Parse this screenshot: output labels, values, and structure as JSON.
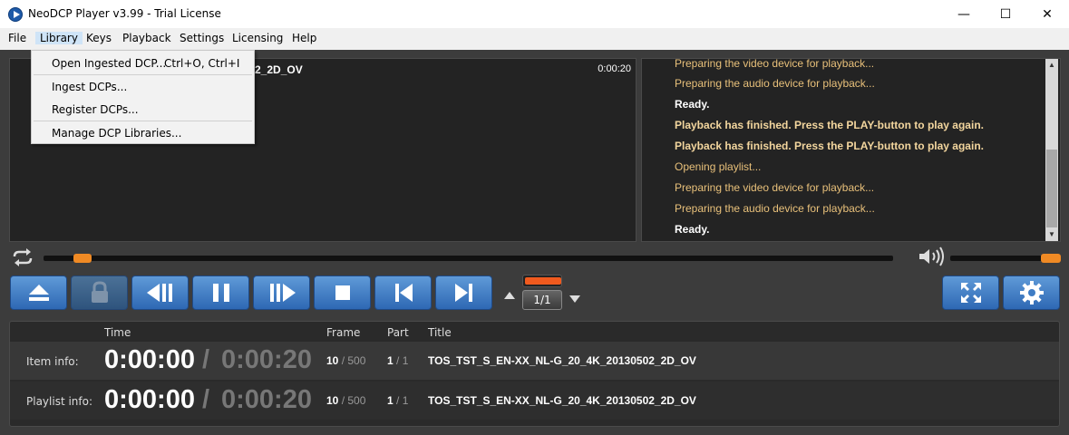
{
  "window": {
    "title": "NeoDCP Player v3.99 - Trial License",
    "minimize": "—",
    "maximize": "☐",
    "close": "✕"
  },
  "menubar": {
    "items": [
      "File",
      "Library",
      "Keys",
      "Playback",
      "Settings",
      "Licensing",
      "Help"
    ],
    "active": "Library"
  },
  "library_menu": {
    "items": [
      {
        "label": "Open Ingested DCP...",
        "shortcut": "Ctrl+O, Ctrl+I"
      },
      {
        "label": "Ingest DCPs...",
        "shortcut": ""
      },
      {
        "label": "Register DCPs...",
        "shortcut": ""
      },
      {
        "label": "Manage DCP Libraries...",
        "shortcut": ""
      }
    ]
  },
  "video": {
    "title_fragment": "2_2D_OV",
    "time": "0:00:20"
  },
  "log": {
    "lines": [
      {
        "text": "Preparing the video device for playback...",
        "style": "normal"
      },
      {
        "text": "Preparing the audio device for playback...",
        "style": "normal"
      },
      {
        "text": "Ready.",
        "style": "ready"
      },
      {
        "text": "Playback has finished. Press the PLAY-button to play again.",
        "style": "bold"
      },
      {
        "text": "Playback has finished. Press the PLAY-button to play again.",
        "style": "bold"
      },
      {
        "text": "Opening playlist...",
        "style": "normal"
      },
      {
        "text": "Preparing the video device for playback...",
        "style": "normal"
      },
      {
        "text": "Preparing the audio device for playback...",
        "style": "normal"
      },
      {
        "text": "Ready.",
        "style": "ready"
      }
    ]
  },
  "playback": {
    "seek_position": 0.02,
    "volume_level": 0.9,
    "playlist_counter": "1/1"
  },
  "controls": {
    "buttons": [
      "eject-icon",
      "lock-icon",
      "step-back-icon",
      "pause-icon",
      "step-forward-icon",
      "stop-icon",
      "skip-previous-icon",
      "skip-next-icon",
      "fullscreen-icon",
      "settings-icon"
    ]
  },
  "info": {
    "headers": {
      "time": "Time",
      "frame": "Frame",
      "part": "Part",
      "title": "Title"
    },
    "rows": [
      {
        "label": "Item info:",
        "time": "0:00:00",
        "sep": "/",
        "total": "0:00:20",
        "frame": "10",
        "frame_total": "/ 500",
        "part": "1",
        "part_total": "/ 1",
        "title": "TOS_TST_S_EN-XX_NL-G_20_4K_20130502_2D_OV"
      },
      {
        "label": "Playlist info:",
        "time": "0:00:00",
        "sep": "/",
        "total": "0:00:20",
        "frame": "10",
        "frame_total": "/ 500",
        "part": "1",
        "part_total": "/ 1",
        "title": "TOS_TST_S_EN-XX_NL-G_20_4K_20130502_2D_OV"
      }
    ]
  },
  "colors": {
    "accent_orange": "#f08a24",
    "button_blue": "#3f7cc4",
    "log_text": "#e8c07a"
  }
}
